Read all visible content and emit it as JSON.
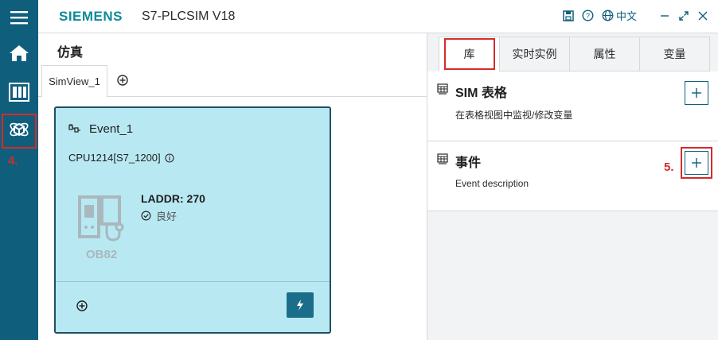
{
  "window": {
    "brand": "SIEMENS",
    "app_title": "S7-PLCSIM V18",
    "language": "中文",
    "icons": [
      "save-icon",
      "help-icon",
      "globe-icon",
      "minimize-icon",
      "maximize-icon",
      "close-icon"
    ]
  },
  "rail": {
    "icons": [
      "menu-icon",
      "home-icon",
      "io-module-icon",
      "simulation-cube-icon"
    ],
    "step_annotation": "4."
  },
  "simulation": {
    "title": "仿真",
    "tab_label": "SimView_1",
    "event_card": {
      "title": "Event_1",
      "cpu": "CPU1214[S7_1200]",
      "ob_label": "OB82",
      "laddr": "LADDR: 270",
      "status": "良好"
    }
  },
  "right_panel": {
    "tabs": [
      "库",
      "实时实例",
      "属性",
      "变量"
    ],
    "active_tab": "库",
    "library": [
      {
        "title": "SIM 表格",
        "description": "在表格视图中监视/修改变量"
      },
      {
        "title": "事件",
        "description": "Event description"
      }
    ],
    "step_annotation": "5."
  },
  "colors": {
    "rail": "#0f5f7c",
    "brand": "#0e8a9a",
    "card": "#b8e9f3",
    "highlight": "#d52b2b"
  }
}
